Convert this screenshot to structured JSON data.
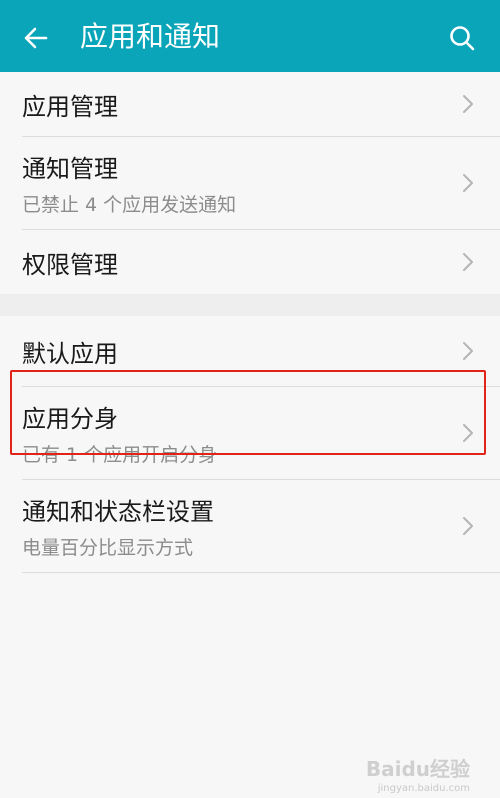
{
  "colors": {
    "accent": "#0aa5b8",
    "highlight": "#e2231a"
  },
  "header": {
    "title": "应用和通知",
    "back_icon": "arrow-left-icon",
    "search_icon": "search-icon"
  },
  "groups": [
    {
      "items": [
        {
          "label": "应用管理",
          "sub": ""
        },
        {
          "label": "通知管理",
          "sub": "已禁止 4 个应用发送通知"
        },
        {
          "label": "权限管理",
          "sub": ""
        }
      ]
    },
    {
      "items": [
        {
          "label": "默认应用",
          "sub": ""
        },
        {
          "label": "应用分身",
          "sub": "已有 1 个应用开启分身"
        },
        {
          "label": "通知和状态栏设置",
          "sub": "电量百分比显示方式"
        }
      ]
    }
  ],
  "watermark": {
    "text": "Baidu经验",
    "sub": "jingyan.baidu.com"
  }
}
